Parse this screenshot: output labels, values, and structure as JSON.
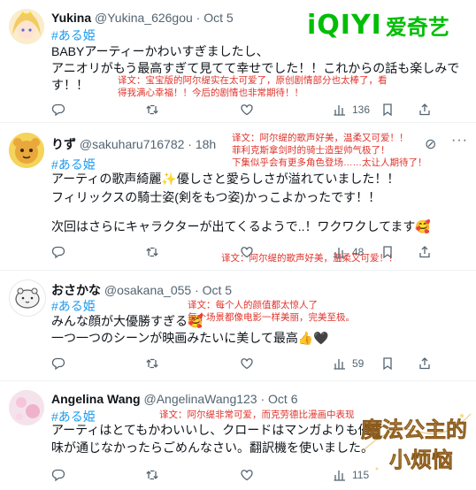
{
  "watermark": {
    "brand_en": "iQIYI",
    "brand_cn": "爱奇艺"
  },
  "tweets": [
    {
      "name": "Yukina",
      "handle": "@Yukina_626gou · Oct 5",
      "hashtag": "#ある姫",
      "lines": [
        "BABYアーティーかわいすぎましたし、",
        "アニオリがもう最高すぎて見てて幸せでした！！これからの話も楽しみで",
        "す！！"
      ],
      "translation": [
        "译文：宝宝版的阿尔缇实在太可爱了，原创剧情部分也太棒了，看",
        "得我满心幸福！！今后的剧情也非常期待！！"
      ],
      "views": "136"
    },
    {
      "name": "りず",
      "handle": "@sakuharu716782 · 18h",
      "hashtag": "#ある姫",
      "lines": [
        "アーティの歌声綺麗✨優しさと愛らしさが溢れていました！！",
        "フィリックスの騎士姿(剣をもつ姿)かっこよかったです！！",
        "",
        "次回はさらにキャラクターが出てくるようで..！ワクワクしてます🥰"
      ],
      "translation": [
        "译文：阿尔缇的歌声好美，温柔又可爱！！",
        "菲利克斯拿剑时的骑士造型帅气极了！",
        "下集似乎会有更多角色登场……太让人期待了！"
      ],
      "views": "48"
    },
    {
      "name": "おさかな",
      "handle": "@osakana_055 · Oct 5",
      "hashtag": "#ある姫",
      "lines": [
        "みんな顔が大優勝すぎる🥰",
        "一つ一つのシーンが映画みたいに美して最高👍🖤"
      ],
      "translation": [
        "译文：每个人的颜值都太惊人了",
        "每个场景都像电影一样美丽，完美至极。"
      ],
      "views": "59"
    },
    {
      "name": "Angelina Wang",
      "handle": "@AngelinaWang123 · Oct 6",
      "hashtag": "#ある姫",
      "lines": [
        "アーティはとてもかわいいし、クロードはマンガよりも優",
        "味が通じなかったらごめんなさい。翻訳機を使いました。"
      ],
      "translation": [
        "译文：阿尔缇非常可爱，而克劳德比漫画中表现"
      ],
      "views": "115"
    }
  ],
  "poster_title": "魔法公主的小烦恼"
}
